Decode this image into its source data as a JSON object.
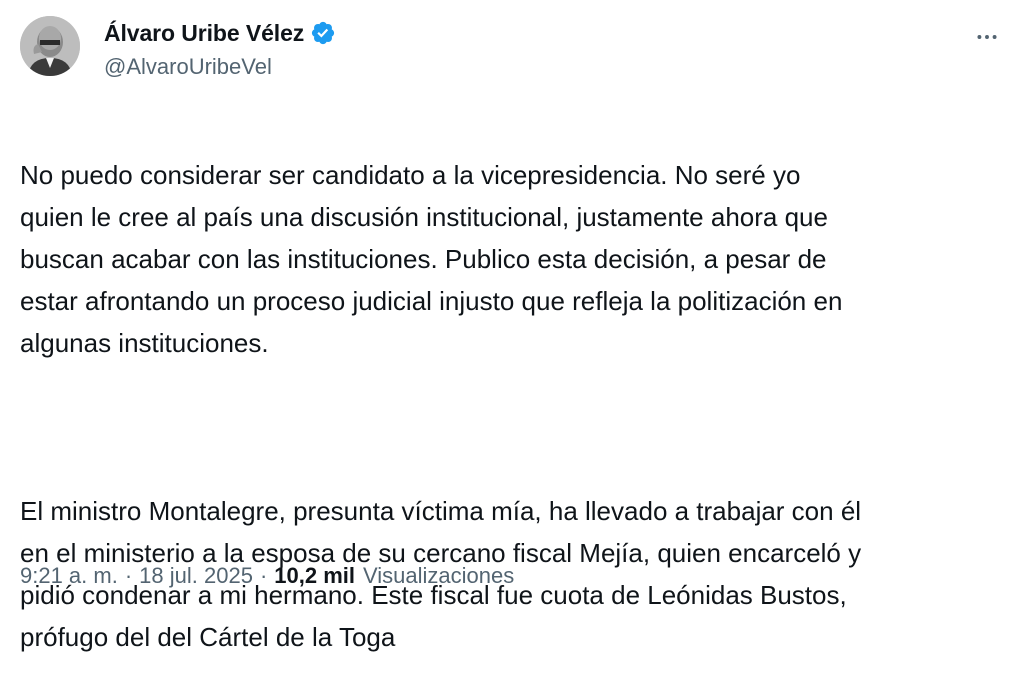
{
  "author": {
    "name": "Álvaro Uribe Vélez",
    "handle": "@AlvaroUribeVel",
    "verified_color": "#1d9bf0"
  },
  "tweet": {
    "paragraph1": "No puedo considerar ser candidato a la vicepresidencia. No seré yo\nquien le cree al país una discusión institucional, justamente ahora que\nbuscan acabar con las instituciones. Publico esta decisión, a pesar de\nestar afrontando un proceso judicial injusto que refleja la politización en\nalgunas instituciones.",
    "paragraph2": "El ministro Montalegre, presunta víctima mía, ha llevado a trabajar con él\nen el ministerio a la esposa de su cercano fiscal Mejía, quien encarceló y\npidió condenar a mi hermano. Este fiscal fue cuota de Leónidas Bustos,\nprófugo del  del Cártel de la Toga"
  },
  "meta": {
    "time": "9:21 a. m.",
    "separator": "·",
    "date": "18 jul. 2025",
    "views_count": "10,2 mil",
    "views_label": "Visualizaciones"
  },
  "icons": {
    "more": "more-horizontal-icon",
    "verified": "verified-badge-icon"
  }
}
